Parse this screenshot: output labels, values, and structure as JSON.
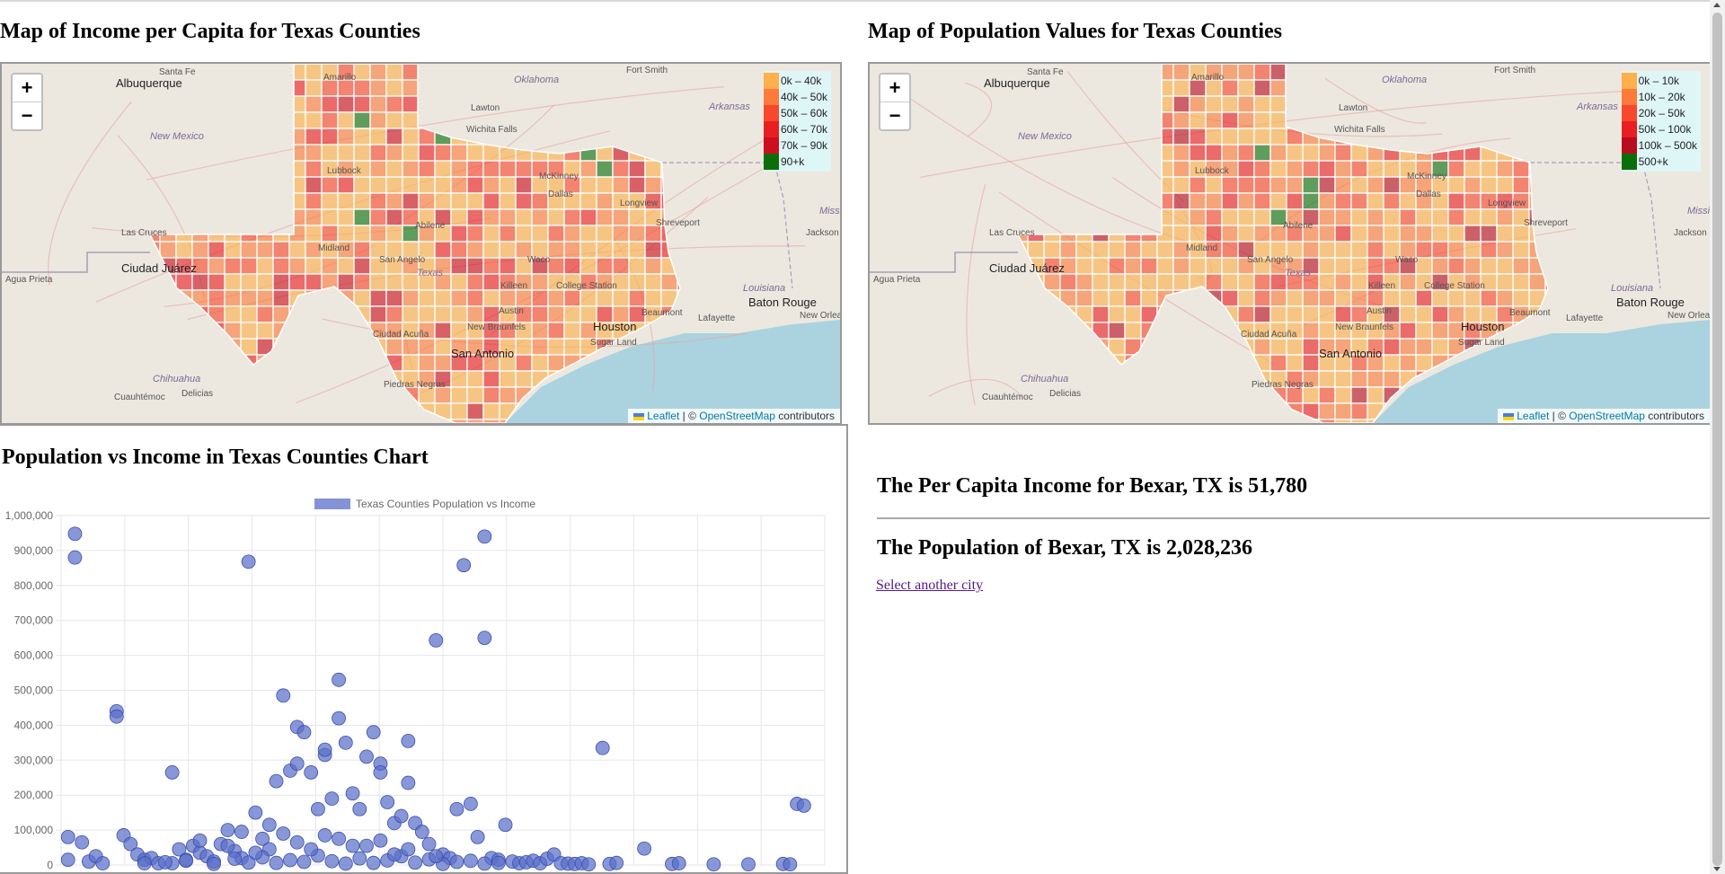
{
  "page": {
    "income_map_title": "Map of Income per Capita for Texas Counties",
    "population_map_title": "Map of Population Values for Texas Counties",
    "chart_title": "Population vs Income in Texas Counties Chart"
  },
  "map_controls": {
    "zoom_in": "+",
    "zoom_out": "−"
  },
  "attribution": {
    "leaflet": "Leaflet",
    "separator": " | © ",
    "osm": "OpenStreetMap",
    "suffix": " contributors"
  },
  "income_legend": [
    {
      "label": "0k – 40k",
      "color": "#fdb04b"
    },
    {
      "label": "40k – 50k",
      "color": "#fc7b3a"
    },
    {
      "label": "50k – 60k",
      "color": "#f7472c"
    },
    {
      "label": "60k – 70k",
      "color": "#e81f20"
    },
    {
      "label": "70k – 90k",
      "color": "#cc0f1f"
    },
    {
      "label": "90+k",
      "color": "#0a6e0a"
    }
  ],
  "population_legend": [
    {
      "label": "0k – 10k",
      "color": "#fdb04b"
    },
    {
      "label": "10k – 20k",
      "color": "#fc7b3a"
    },
    {
      "label": "20k – 50k",
      "color": "#f7472c"
    },
    {
      "label": "50k – 100k",
      "color": "#e81f20"
    },
    {
      "label": "100k – 500k",
      "color": "#b80d1f"
    },
    {
      "label": "500+k",
      "color": "#0a6e0a"
    }
  ],
  "map_labels": {
    "santa_fe": "Santa Fe",
    "albuquerque": "Albuquerque",
    "new_mexico": "New Mexico",
    "amarillo": "Amarillo",
    "oklahoma": "Oklahoma",
    "fort_smith": "Fort Smith",
    "lawton": "Lawton",
    "arkansas": "Arkansas",
    "wichita_falls": "Wichita Falls",
    "lubbock": "Lubbock",
    "mckinney": "McKinney",
    "dallas": "Dallas",
    "longview": "Longview",
    "shreveport": "Shreveport",
    "abilene": "Abilene",
    "jackson": "Jackson",
    "las_cruces": "Las Cruces",
    "midland": "Midland",
    "ciudad_juarez": "Ciudad Juárez",
    "san_angelo": "San Angelo",
    "texas": "Texas",
    "waco": "Waco",
    "agua_prieta": "Agua Prieta",
    "killeen": "Killeen",
    "college_station": "College Station",
    "louisiana": "Louisiana",
    "baton_rouge": "Baton Rouge",
    "austin": "Austin",
    "beaumont": "Beaumont",
    "lafayette": "Lafayette",
    "new_orleans": "New Orleans",
    "new_braunfels": "New Braunfels",
    "houston": "Houston",
    "ciudad_acuna": "Ciudad Acuña",
    "sugar_land": "Sugar Land",
    "san_antonio": "San Antonio",
    "chihuahua": "Chihuahua",
    "piedras_negras": "Piedras Negras",
    "cuauhtemoc": "Cuauhtémoc",
    "delicias": "Delicias",
    "mississippi": "Missi"
  },
  "info": {
    "income_line": "The Per Capita Income for Bexar, TX is 51,780",
    "population_line": "The Population of Bexar, TX is 2,028,236",
    "select_link": "Select another city"
  },
  "chart_data": {
    "type": "scatter",
    "legend": "Texas Counties Population vs Income",
    "color": "#5a6fc7",
    "ylim": [
      0,
      1000000
    ],
    "y_ticks": [
      0,
      100000,
      200000,
      300000,
      400000,
      500000,
      600000,
      700000,
      800000,
      900000,
      1000000
    ],
    "y_tick_labels": [
      "0",
      "100,000",
      "200,000",
      "300,000",
      "400,000",
      "500,000",
      "600,000",
      "700,000",
      "800,000",
      "900,000",
      "1,000,000"
    ],
    "grid": true,
    "points": [
      [
        1,
        80000
      ],
      [
        1,
        15000
      ],
      [
        2,
        880000
      ],
      [
        2,
        948000
      ],
      [
        3,
        65000
      ],
      [
        4,
        10000
      ],
      [
        5,
        25000
      ],
      [
        6,
        5000
      ],
      [
        8,
        440000
      ],
      [
        8,
        425000
      ],
      [
        9,
        85000
      ],
      [
        10,
        60000
      ],
      [
        11,
        30000
      ],
      [
        12,
        15000
      ],
      [
        13,
        20000
      ],
      [
        14,
        5000
      ],
      [
        16,
        265000
      ],
      [
        16,
        5000
      ],
      [
        17,
        45000
      ],
      [
        18,
        15000
      ],
      [
        19,
        55000
      ],
      [
        20,
        35000
      ],
      [
        21,
        25000
      ],
      [
        22,
        10000
      ],
      [
        23,
        60000
      ],
      [
        24,
        100000
      ],
      [
        25,
        40000
      ],
      [
        26,
        20000
      ],
      [
        27,
        868000
      ],
      [
        28,
        150000
      ],
      [
        29,
        75000
      ],
      [
        30,
        45000
      ],
      [
        31,
        240000
      ],
      [
        32,
        485000
      ],
      [
        33,
        270000
      ],
      [
        34,
        395000
      ],
      [
        34,
        290000
      ],
      [
        35,
        380000
      ],
      [
        36,
        265000
      ],
      [
        37,
        160000
      ],
      [
        38,
        315000
      ],
      [
        38,
        330000
      ],
      [
        39,
        190000
      ],
      [
        40,
        530000
      ],
      [
        40,
        420000
      ],
      [
        41,
        350000
      ],
      [
        42,
        205000
      ],
      [
        43,
        160000
      ],
      [
        44,
        310000
      ],
      [
        45,
        380000
      ],
      [
        46,
        290000
      ],
      [
        46,
        265000
      ],
      [
        47,
        180000
      ],
      [
        48,
        120000
      ],
      [
        49,
        140000
      ],
      [
        50,
        235000
      ],
      [
        50,
        355000
      ],
      [
        51,
        120000
      ],
      [
        52,
        95000
      ],
      [
        53,
        60000
      ],
      [
        54,
        643000
      ],
      [
        55,
        30000
      ],
      [
        56,
        20000
      ],
      [
        57,
        160000
      ],
      [
        58,
        858000
      ],
      [
        59,
        175000
      ],
      [
        60,
        80000
      ],
      [
        61,
        940000
      ],
      [
        61,
        650000
      ],
      [
        62,
        20000
      ],
      [
        63,
        15000
      ],
      [
        64,
        115000
      ],
      [
        65,
        10000
      ],
      [
        66,
        5000
      ],
      [
        67,
        8000
      ],
      [
        68,
        12000
      ],
      [
        69,
        5000
      ],
      [
        70,
        18000
      ],
      [
        71,
        30000
      ],
      [
        72,
        5000
      ],
      [
        73,
        4000
      ],
      [
        74,
        3000
      ],
      [
        75,
        5000
      ],
      [
        76,
        2000
      ],
      [
        78,
        335000
      ],
      [
        79,
        3000
      ],
      [
        80,
        6000
      ],
      [
        84,
        47000
      ],
      [
        88,
        3000
      ],
      [
        89,
        5000
      ],
      [
        94,
        2000
      ],
      [
        99,
        2000
      ],
      [
        104,
        3000
      ],
      [
        105,
        2000
      ],
      [
        106,
        175000
      ],
      [
        107,
        170000
      ],
      [
        12,
        5000
      ],
      [
        15,
        8000
      ],
      [
        18,
        12000
      ],
      [
        22,
        3000
      ],
      [
        25,
        18000
      ],
      [
        27,
        7000
      ],
      [
        29,
        22000
      ],
      [
        31,
        6000
      ],
      [
        33,
        14000
      ],
      [
        35,
        9000
      ],
      [
        37,
        27000
      ],
      [
        39,
        11000
      ],
      [
        41,
        4000
      ],
      [
        43,
        19000
      ],
      [
        45,
        6000
      ],
      [
        47,
        13000
      ],
      [
        49,
        25000
      ],
      [
        51,
        7000
      ],
      [
        53,
        16000
      ],
      [
        55,
        3000
      ],
      [
        57,
        9000
      ],
      [
        59,
        12000
      ],
      [
        61,
        4000
      ],
      [
        63,
        6000
      ],
      [
        20,
        70000
      ],
      [
        24,
        55000
      ],
      [
        28,
        35000
      ],
      [
        32,
        90000
      ],
      [
        36,
        45000
      ],
      [
        40,
        75000
      ],
      [
        44,
        55000
      ],
      [
        48,
        30000
      ],
      [
        26,
        95000
      ],
      [
        30,
        115000
      ],
      [
        34,
        65000
      ],
      [
        38,
        85000
      ],
      [
        42,
        55000
      ],
      [
        46,
        70000
      ],
      [
        50,
        45000
      ],
      [
        54,
        25000
      ]
    ]
  }
}
